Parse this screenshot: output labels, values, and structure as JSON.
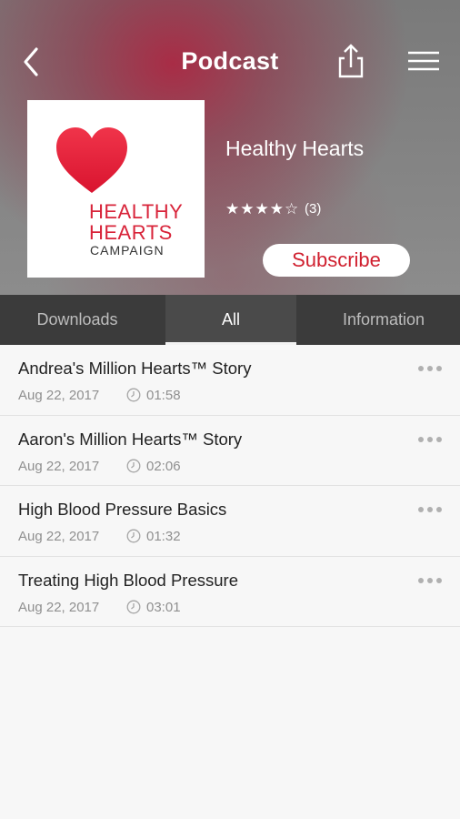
{
  "nav": {
    "title": "Podcast",
    "back_icon": "chevron-left-icon",
    "share_icon": "share-icon",
    "menu_icon": "hamburger-menu-icon"
  },
  "podcast": {
    "artwork_text": [
      "HEALTHY",
      "HEARTS",
      "CAMPAIGN"
    ],
    "name": "Healthy Hearts",
    "stars": "★★★★☆",
    "rating_value": 4,
    "rating_max": 5,
    "rating_count": "(3)",
    "subscribe_label": "Subscribe"
  },
  "tabs": [
    {
      "label": "Downloads",
      "active": false
    },
    {
      "label": "All",
      "active": true
    },
    {
      "label": "Information",
      "active": false
    }
  ],
  "episodes": [
    {
      "title": "Andrea's Million Hearts™ Story",
      "date": "Aug 22, 2017",
      "duration": "01:58"
    },
    {
      "title": "Aaron's Million Hearts™ Story",
      "date": "Aug 22, 2017",
      "duration": "02:06"
    },
    {
      "title": "High Blood Pressure Basics",
      "date": "Aug 22, 2017",
      "duration": "01:32"
    },
    {
      "title": "Treating High Blood Pressure",
      "date": "Aug 22, 2017",
      "duration": "03:01"
    }
  ],
  "colors": {
    "accent_red": "#d8243a",
    "tab_bar": "#3b3b3b",
    "list_bg": "#f7f7f7"
  }
}
